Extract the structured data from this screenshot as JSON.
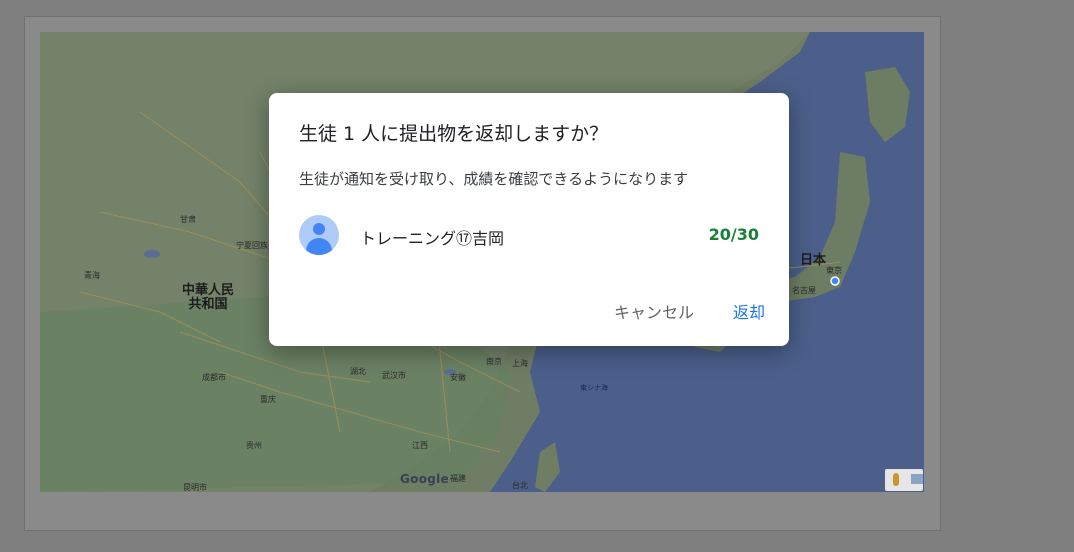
{
  "map": {
    "labels": {
      "china": "中華人民\n共和国",
      "japan": "日本",
      "tokyo": "東京",
      "nagoya": "名古屋",
      "chengdu": "成都市",
      "chongqing": "重庆",
      "wuhan": "武汉市",
      "shanghai": "上海",
      "nanjing": "南京",
      "taipei": "台北",
      "kunming": "昆明市",
      "east_china_sea": "東シナ海",
      "gansu": "甘肃",
      "qinghai": "青海",
      "ningxia": "宁夏回族自治区",
      "hubei": "湖北",
      "anhui": "安徽",
      "jiangxi": "江西",
      "guizhou": "贵州",
      "fujian": "福建"
    },
    "google": "Google"
  },
  "dialog": {
    "title": "生徒 1 人に提出物を返却しますか？",
    "description": "生徒が通知を受け取り、成績を確認できるようになります",
    "student": {
      "name": "トレーニング⑰吉岡",
      "score": "20/30"
    },
    "cancel_label": "キャンセル",
    "return_label": "返却"
  },
  "colors": {
    "accent": "#1a73e8",
    "score": "#188038"
  }
}
